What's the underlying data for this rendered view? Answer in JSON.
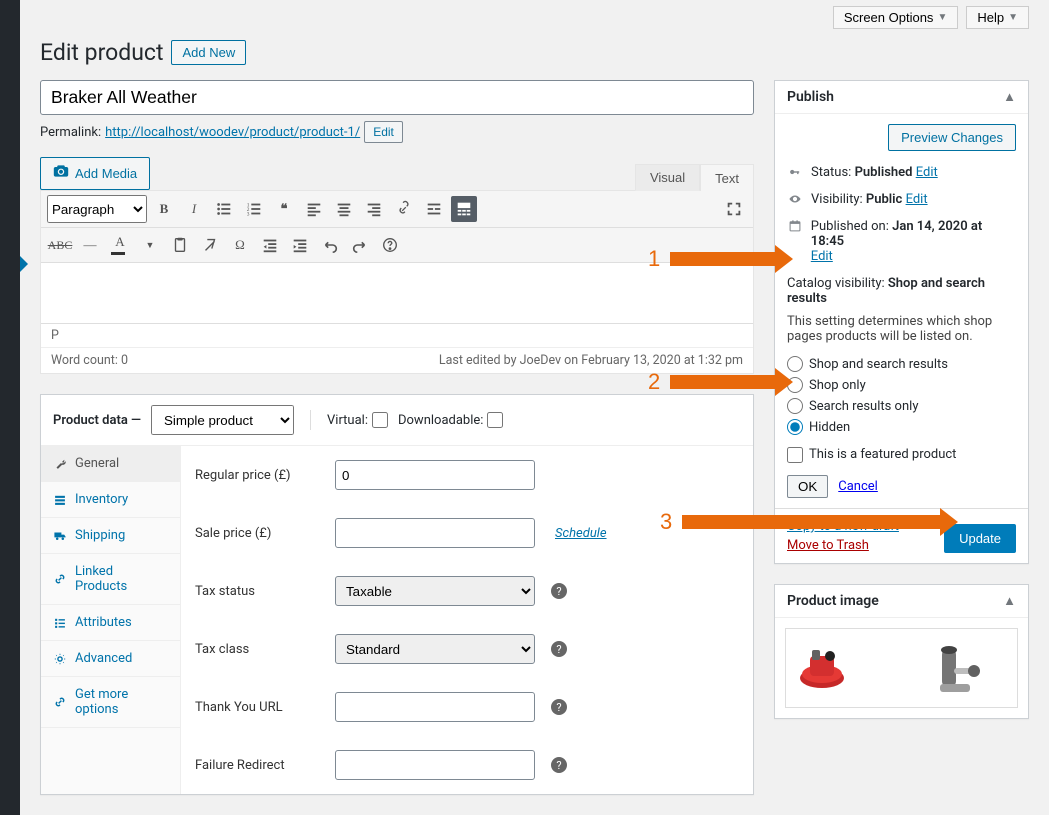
{
  "top": {
    "screen_options": "Screen Options",
    "help": "Help"
  },
  "header": {
    "title": "Edit product",
    "add_new": "Add New"
  },
  "title_field": {
    "value": "Braker All Weather"
  },
  "permalink": {
    "label": "Permalink:",
    "url": "http://localhost/woodev/product/product-1/",
    "edit": "Edit"
  },
  "media": {
    "add": "Add Media"
  },
  "editor": {
    "tab_visual": "Visual",
    "tab_text": "Text",
    "format_select": "Paragraph",
    "status_tag": "P",
    "word_count_label": "Word count:",
    "word_count": "0",
    "last_edited": "Last edited by JoeDev on February 13, 2020 at 1:32 pm"
  },
  "product_data": {
    "heading": "Product data",
    "type_select": "Simple product",
    "virtual": "Virtual:",
    "downloadable": "Downloadable:",
    "tabs": {
      "general": "General",
      "inventory": "Inventory",
      "shipping": "Shipping",
      "linked": "Linked Products",
      "attributes": "Attributes",
      "advanced": "Advanced",
      "more": "Get more options"
    },
    "fields": {
      "regular_price_label": "Regular price (£)",
      "regular_price_value": "0",
      "sale_price_label": "Sale price (£)",
      "schedule": "Schedule",
      "tax_status_label": "Tax status",
      "tax_status_value": "Taxable",
      "tax_class_label": "Tax class",
      "tax_class_value": "Standard",
      "thank_you_label": "Thank You URL",
      "failure_label": "Failure Redirect"
    }
  },
  "publish": {
    "heading": "Publish",
    "preview": "Preview Changes",
    "status_label": "Status:",
    "status_value": "Published",
    "visibility_label": "Visibility:",
    "visibility_value": "Public",
    "published_label": "Published on:",
    "published_value": "Jan 14, 2020 at 18:45",
    "edit": "Edit",
    "catalog_label": "Catalog visibility:",
    "catalog_value": "Shop and search results",
    "catalog_desc": "This setting determines which shop pages products will be listed on.",
    "opt_shop_search": "Shop and search results",
    "opt_shop": "Shop only",
    "opt_search": "Search results only",
    "opt_hidden": "Hidden",
    "featured": "This is a featured product",
    "ok": "OK",
    "cancel": "Cancel",
    "copy": "Copy to a new draft",
    "trash": "Move to Trash",
    "update": "Update"
  },
  "product_image": {
    "heading": "Product image"
  },
  "annotations": {
    "a1": "1",
    "a2": "2",
    "a3": "3"
  }
}
